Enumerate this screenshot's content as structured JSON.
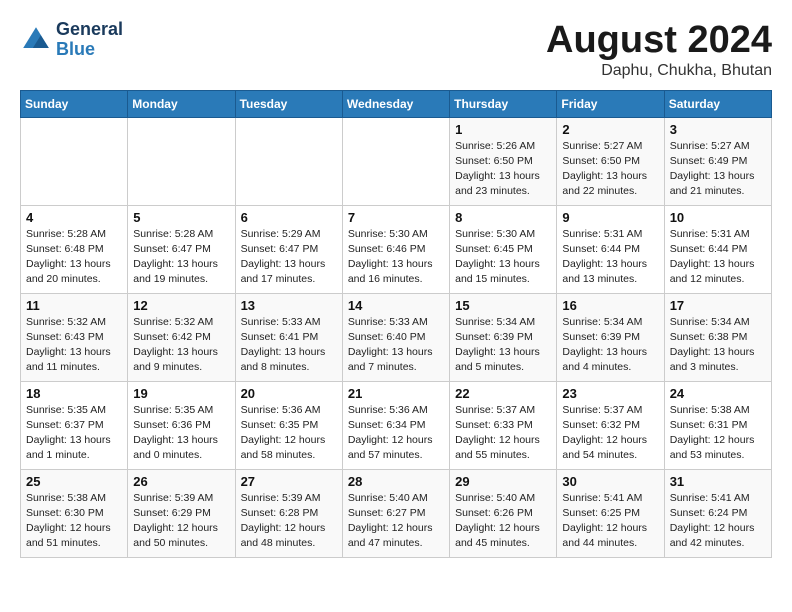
{
  "logo": {
    "line1": "General",
    "line2": "Blue"
  },
  "title": "August 2024",
  "subtitle": "Daphu, Chukha, Bhutan",
  "days_of_week": [
    "Sunday",
    "Monday",
    "Tuesday",
    "Wednesday",
    "Thursday",
    "Friday",
    "Saturday"
  ],
  "weeks": [
    [
      {
        "day": "",
        "info": ""
      },
      {
        "day": "",
        "info": ""
      },
      {
        "day": "",
        "info": ""
      },
      {
        "day": "",
        "info": ""
      },
      {
        "day": "1",
        "info": "Sunrise: 5:26 AM\nSunset: 6:50 PM\nDaylight: 13 hours\nand 23 minutes."
      },
      {
        "day": "2",
        "info": "Sunrise: 5:27 AM\nSunset: 6:50 PM\nDaylight: 13 hours\nand 22 minutes."
      },
      {
        "day": "3",
        "info": "Sunrise: 5:27 AM\nSunset: 6:49 PM\nDaylight: 13 hours\nand 21 minutes."
      }
    ],
    [
      {
        "day": "4",
        "info": "Sunrise: 5:28 AM\nSunset: 6:48 PM\nDaylight: 13 hours\nand 20 minutes."
      },
      {
        "day": "5",
        "info": "Sunrise: 5:28 AM\nSunset: 6:47 PM\nDaylight: 13 hours\nand 19 minutes."
      },
      {
        "day": "6",
        "info": "Sunrise: 5:29 AM\nSunset: 6:47 PM\nDaylight: 13 hours\nand 17 minutes."
      },
      {
        "day": "7",
        "info": "Sunrise: 5:30 AM\nSunset: 6:46 PM\nDaylight: 13 hours\nand 16 minutes."
      },
      {
        "day": "8",
        "info": "Sunrise: 5:30 AM\nSunset: 6:45 PM\nDaylight: 13 hours\nand 15 minutes."
      },
      {
        "day": "9",
        "info": "Sunrise: 5:31 AM\nSunset: 6:44 PM\nDaylight: 13 hours\nand 13 minutes."
      },
      {
        "day": "10",
        "info": "Sunrise: 5:31 AM\nSunset: 6:44 PM\nDaylight: 13 hours\nand 12 minutes."
      }
    ],
    [
      {
        "day": "11",
        "info": "Sunrise: 5:32 AM\nSunset: 6:43 PM\nDaylight: 13 hours\nand 11 minutes."
      },
      {
        "day": "12",
        "info": "Sunrise: 5:32 AM\nSunset: 6:42 PM\nDaylight: 13 hours\nand 9 minutes."
      },
      {
        "day": "13",
        "info": "Sunrise: 5:33 AM\nSunset: 6:41 PM\nDaylight: 13 hours\nand 8 minutes."
      },
      {
        "day": "14",
        "info": "Sunrise: 5:33 AM\nSunset: 6:40 PM\nDaylight: 13 hours\nand 7 minutes."
      },
      {
        "day": "15",
        "info": "Sunrise: 5:34 AM\nSunset: 6:39 PM\nDaylight: 13 hours\nand 5 minutes."
      },
      {
        "day": "16",
        "info": "Sunrise: 5:34 AM\nSunset: 6:39 PM\nDaylight: 13 hours\nand 4 minutes."
      },
      {
        "day": "17",
        "info": "Sunrise: 5:34 AM\nSunset: 6:38 PM\nDaylight: 13 hours\nand 3 minutes."
      }
    ],
    [
      {
        "day": "18",
        "info": "Sunrise: 5:35 AM\nSunset: 6:37 PM\nDaylight: 13 hours\nand 1 minute."
      },
      {
        "day": "19",
        "info": "Sunrise: 5:35 AM\nSunset: 6:36 PM\nDaylight: 13 hours\nand 0 minutes."
      },
      {
        "day": "20",
        "info": "Sunrise: 5:36 AM\nSunset: 6:35 PM\nDaylight: 12 hours\nand 58 minutes."
      },
      {
        "day": "21",
        "info": "Sunrise: 5:36 AM\nSunset: 6:34 PM\nDaylight: 12 hours\nand 57 minutes."
      },
      {
        "day": "22",
        "info": "Sunrise: 5:37 AM\nSunset: 6:33 PM\nDaylight: 12 hours\nand 55 minutes."
      },
      {
        "day": "23",
        "info": "Sunrise: 5:37 AM\nSunset: 6:32 PM\nDaylight: 12 hours\nand 54 minutes."
      },
      {
        "day": "24",
        "info": "Sunrise: 5:38 AM\nSunset: 6:31 PM\nDaylight: 12 hours\nand 53 minutes."
      }
    ],
    [
      {
        "day": "25",
        "info": "Sunrise: 5:38 AM\nSunset: 6:30 PM\nDaylight: 12 hours\nand 51 minutes."
      },
      {
        "day": "26",
        "info": "Sunrise: 5:39 AM\nSunset: 6:29 PM\nDaylight: 12 hours\nand 50 minutes."
      },
      {
        "day": "27",
        "info": "Sunrise: 5:39 AM\nSunset: 6:28 PM\nDaylight: 12 hours\nand 48 minutes."
      },
      {
        "day": "28",
        "info": "Sunrise: 5:40 AM\nSunset: 6:27 PM\nDaylight: 12 hours\nand 47 minutes."
      },
      {
        "day": "29",
        "info": "Sunrise: 5:40 AM\nSunset: 6:26 PM\nDaylight: 12 hours\nand 45 minutes."
      },
      {
        "day": "30",
        "info": "Sunrise: 5:41 AM\nSunset: 6:25 PM\nDaylight: 12 hours\nand 44 minutes."
      },
      {
        "day": "31",
        "info": "Sunrise: 5:41 AM\nSunset: 6:24 PM\nDaylight: 12 hours\nand 42 minutes."
      }
    ]
  ]
}
